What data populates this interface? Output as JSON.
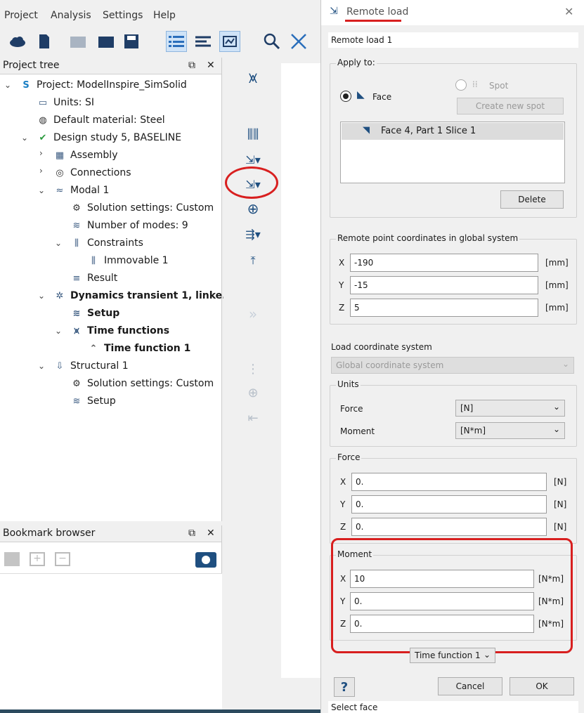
{
  "menu": [
    "Project",
    "Analysis",
    "Settings",
    "Help"
  ],
  "project_tree": {
    "title": "Project tree",
    "items": [
      {
        "label": "Project: ModelInspire_SimSolid",
        "icon": "simsolid-logo-icon"
      },
      {
        "label": "Units: SI",
        "icon": "ruler-icon"
      },
      {
        "label": "Default material: Steel",
        "icon": "material-icon"
      },
      {
        "label": "Design study 5, BASELINE",
        "icon": "design-study-icon"
      },
      {
        "label": "Assembly",
        "icon": "assembly-icon"
      },
      {
        "label": "Connections",
        "icon": "connections-icon"
      },
      {
        "label": "Modal 1",
        "icon": "modal-icon"
      },
      {
        "label": "Solution settings: Custom",
        "icon": "gear-icon"
      },
      {
        "label": "Number of modes: 9",
        "icon": "wave-icon"
      },
      {
        "label": "Constraints",
        "icon": "constraint-icon"
      },
      {
        "label": "Immovable 1",
        "icon": "immovable-icon"
      },
      {
        "label": "Result",
        "icon": "result-icon"
      },
      {
        "label": "Dynamics transient 1, linke...",
        "icon": "dynamics-icon"
      },
      {
        "label": "Setup",
        "icon": "wave-icon"
      },
      {
        "label": "Time functions",
        "icon": "time-function-icon"
      },
      {
        "label": "Time function  1",
        "icon": "pulse-icon"
      },
      {
        "label": "Structural  1",
        "icon": "structural-icon"
      },
      {
        "label": "Solution settings: Custom",
        "icon": "gear-icon"
      },
      {
        "label": "Setup",
        "icon": "wave-icon"
      }
    ]
  },
  "bookmark_browser": {
    "title": "Bookmark browser"
  },
  "dialog": {
    "title": "Remote load",
    "name_value": "Remote load 1",
    "apply_to": {
      "label": "Apply to:",
      "face_label": "Face",
      "spot_label": "Spot",
      "face_selected": true,
      "create_spot_label": "Create new spot",
      "list_items": [
        "Face 4, Part 1 Slice 1"
      ],
      "delete_label": "Delete"
    },
    "remote_point": {
      "label": "Remote point coordinates in global system",
      "rows": [
        {
          "axis": "X",
          "value": "-190",
          "unit": "[mm]"
        },
        {
          "axis": "Y",
          "value": "-15",
          "unit": "[mm]"
        },
        {
          "axis": "Z",
          "value": "5",
          "unit": "[mm]"
        }
      ]
    },
    "load_cs": {
      "label": "Load coordinate system",
      "value": "Global coordinate system"
    },
    "units": {
      "label": "Units",
      "force_label": "Force",
      "force_value": "[N]",
      "moment_label": "Moment",
      "moment_value": "[N*m]"
    },
    "force": {
      "label": "Force",
      "rows": [
        {
          "axis": "X",
          "value": "0.",
          "unit": "[N]"
        },
        {
          "axis": "Y",
          "value": "0.",
          "unit": "[N]"
        },
        {
          "axis": "Z",
          "value": "0.",
          "unit": "[N]"
        }
      ]
    },
    "moment": {
      "label": "Moment",
      "rows": [
        {
          "axis": "X",
          "value": "10",
          "unit": "[N*m]"
        },
        {
          "axis": "Y",
          "value": "0.",
          "unit": "[N*m]"
        },
        {
          "axis": "Z",
          "value": "0.",
          "unit": "[N*m]"
        }
      ]
    },
    "time_function": "Time function  1",
    "help_label": "?",
    "cancel_label": "Cancel",
    "ok_label": "OK",
    "status": "Select face"
  },
  "colors": {
    "annotation_red": "#d81f1f",
    "accent_blue": "#2a6ebb"
  }
}
